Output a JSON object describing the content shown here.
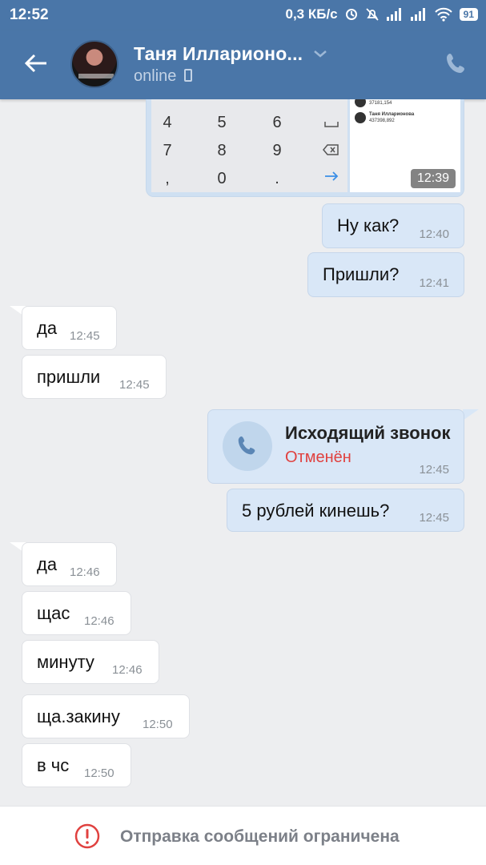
{
  "status_bar": {
    "time": "12:52",
    "network_speed": "0,3 КБ/с",
    "battery": "91"
  },
  "header": {
    "name": "Таня Илларионо...",
    "status": "online"
  },
  "image_message": {
    "keys": [
      "4",
      "5",
      "6",
      "7",
      "8",
      "9",
      ",",
      "0",
      "."
    ],
    "preview_name": "Таня Илларионова",
    "preview_line1": "37181,154",
    "preview_line2": "437398,892",
    "time": "12:39"
  },
  "messages": [
    {
      "dir": "out",
      "text": "Ну как?",
      "time": "12:40"
    },
    {
      "dir": "out",
      "text": "Пришли?",
      "time": "12:41"
    },
    {
      "dir": "in",
      "text": "да",
      "time": "12:45"
    },
    {
      "dir": "in",
      "text": "пришли",
      "time": "12:45"
    },
    {
      "dir": "out",
      "text": "5 рублей кинешь?",
      "time": "12:45"
    },
    {
      "dir": "in",
      "text": "да",
      "time": "12:46"
    },
    {
      "dir": "in",
      "text": "щас",
      "time": "12:46"
    },
    {
      "dir": "in",
      "text": "минуту",
      "time": "12:46"
    },
    {
      "dir": "in",
      "text": "ща.закину",
      "time": "12:50"
    },
    {
      "dir": "in",
      "text": "в чс",
      "time": "12:50"
    }
  ],
  "call_message": {
    "title": "Исходящий звонок",
    "status": "Отменён",
    "time": "12:45"
  },
  "footer": {
    "text": "Отправка сообщений ограничена"
  },
  "colors": {
    "header": "#4a76a8",
    "background": "#edeef0",
    "outgoing_bubble": "#d9e7f7",
    "cancelled": "#e0413f"
  }
}
